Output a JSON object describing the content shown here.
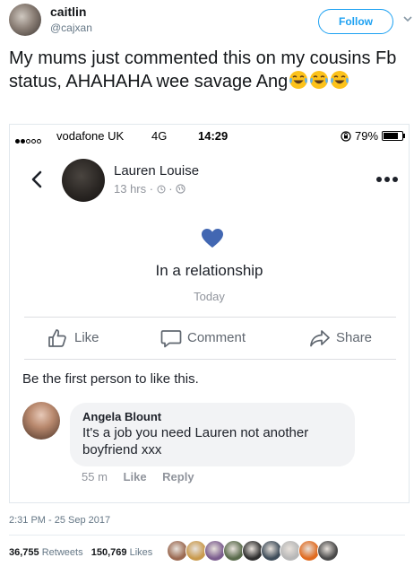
{
  "tweet": {
    "author_name": "caitlin",
    "author_handle": "@cajxan",
    "follow_label": "Follow",
    "text": "My mums just commented this on my cousins Fb status, AHAHAHA wee savage Ang",
    "emoji_count": 3,
    "timestamp": "2:31 PM - 25 Sep 2017",
    "retweets_count": "36,755",
    "retweets_label": "Retweets",
    "likes_count": "150,769",
    "likes_label": "Likes"
  },
  "screenshot": {
    "status_bar": {
      "carrier": "vodafone UK",
      "network": "4G",
      "time": "14:29",
      "battery": "79%",
      "battery_level": 0.79
    },
    "post": {
      "author": "Lauren Louise",
      "meta": "13 hrs · ",
      "life_event": "In a relationship",
      "life_event_date": "Today"
    },
    "actions": {
      "like": "Like",
      "comment": "Comment",
      "share": "Share"
    },
    "first_like_text": "Be the first person to like this.",
    "comment": {
      "author": "Angela Blount",
      "text": "It's a job you need Lauren not another boyfriend xxx",
      "age": "55 m",
      "like": "Like",
      "reply": "Reply"
    }
  },
  "colors": {
    "twitter_blue": "#1da1f2",
    "facebook_blue": "#4267b2",
    "heart_blue": "#4267b2"
  },
  "likers": [
    "#9b6a52",
    "#c99a4d",
    "#7b5d8e",
    "#5a6b4c",
    "#2f2f2f",
    "#3f4d5a",
    "#b7b7b7",
    "#e06a1f",
    "#4a4a4a"
  ]
}
